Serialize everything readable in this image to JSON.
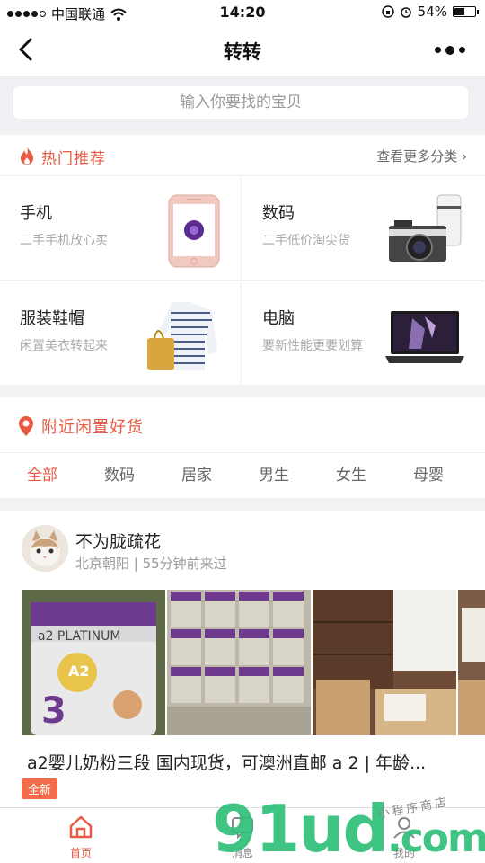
{
  "status_bar": {
    "carrier": "中国联通",
    "time": "14:20",
    "battery": "54%",
    "battery_level": 0.54
  },
  "nav": {
    "title": "转转"
  },
  "search": {
    "placeholder": "输入你要找的宝贝"
  },
  "hot": {
    "title": "热门推荐",
    "more": "查看更多分类",
    "categories": [
      {
        "name": "手机",
        "sub": "二手手机放心买"
      },
      {
        "name": "数码",
        "sub": "二手低价淘尖货"
      },
      {
        "name": "服装鞋帽",
        "sub": "闲置美衣转起来"
      },
      {
        "name": "电脑",
        "sub": "要新性能更要划算"
      }
    ]
  },
  "nearby": {
    "title": "附近闲置好货",
    "tabs": [
      "全部",
      "数码",
      "居家",
      "男生",
      "女生",
      "母婴"
    ]
  },
  "listing": {
    "seller": "不为胧疏花",
    "meta": "北京朝阳 | 55分钟前来过",
    "description": "a2婴儿奶粉三段 国内现货，可澳洲直邮 a 2 | 年龄...",
    "badge": "全新",
    "can_label": "a2 PLATINUM"
  },
  "tabbar": {
    "home": "首页",
    "messages": "消息",
    "me": "我的"
  },
  "watermark": {
    "main": "91ud",
    "suffix": ".com",
    "sub": "小程序商店"
  },
  "colors": {
    "accent": "#e85a43",
    "badge": "#f26b4a",
    "watermark": "#2fbf7a"
  }
}
